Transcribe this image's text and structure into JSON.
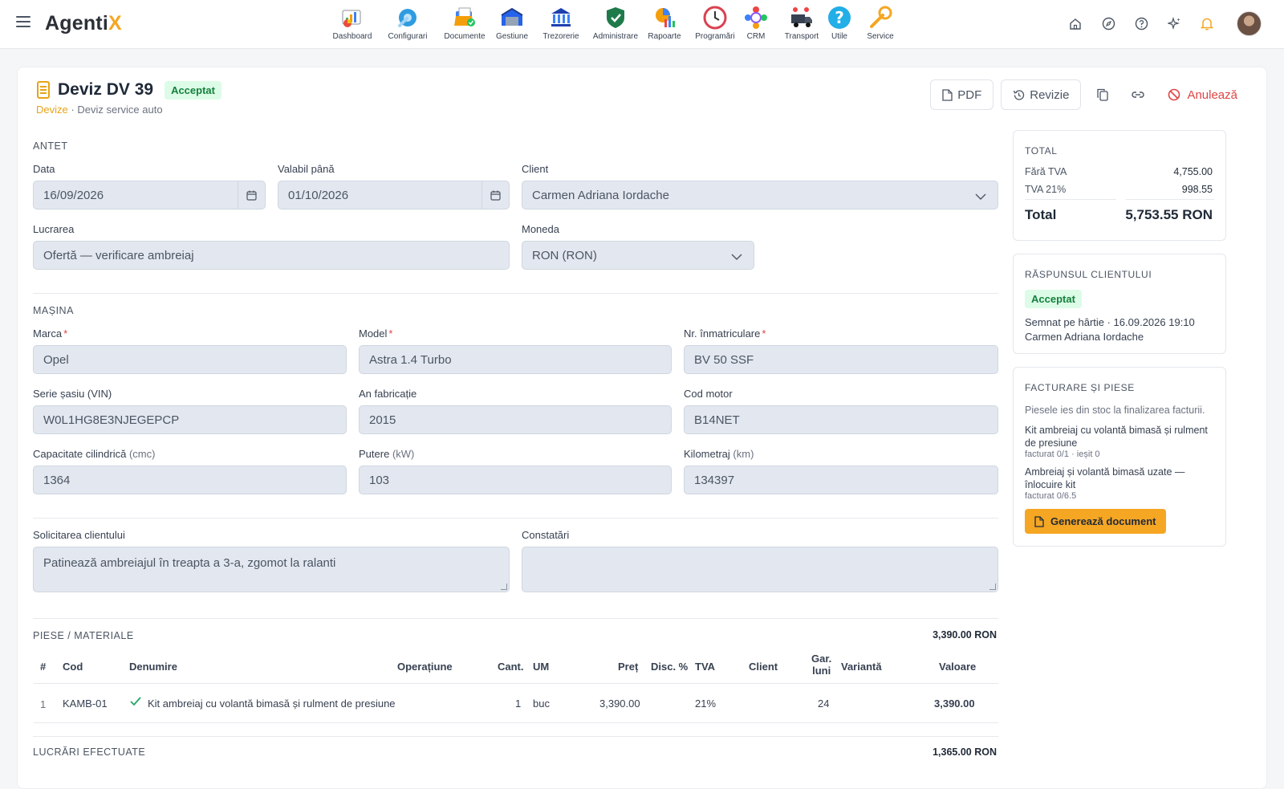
{
  "app": {
    "brand_main": "Agenti",
    "brand_accent": "X",
    "accent_color": "#f5a623"
  },
  "modules": [
    {
      "label": "Dashboard",
      "icon": "dashboard-icon"
    },
    {
      "label": "Configurari",
      "icon": "wrench-gear-icon"
    },
    {
      "label": "Documente",
      "icon": "documents-icon"
    },
    {
      "label": "Gestiune",
      "icon": "warehouse-icon"
    },
    {
      "label": "Trezorerie",
      "icon": "bank-icon"
    },
    {
      "label": "Administrare",
      "icon": "shield-icon"
    },
    {
      "label": "Rapoarte",
      "icon": "reports-icon"
    },
    {
      "label": "Programări",
      "icon": "clock-icon"
    },
    {
      "label": "CRM",
      "icon": "crm-icon"
    },
    {
      "label": "Transport",
      "icon": "truck-icon"
    },
    {
      "label": "Utile",
      "icon": "help-icon"
    },
    {
      "label": "Service",
      "icon": "wrench-icon"
    }
  ],
  "header": {
    "title": "Deviz DV 39",
    "status": "Acceptat",
    "breadcrumb_link": "Devize",
    "breadcrumb_separator": "·",
    "breadcrumb_current": "Deviz service auto",
    "pdf_label": "PDF",
    "revision_label": "Revizie",
    "cancel_label": "Anulează"
  },
  "antet": {
    "section_title": "ANTET",
    "date_label": "Data",
    "date_value": "16/09/2026",
    "valid_label": "Valabil până",
    "valid_value": "01/10/2026",
    "client_label": "Client",
    "client_value": "Carmen Adriana Iordache",
    "work_label": "Lucrarea",
    "work_value": "Ofertă — verificare ambreiaj",
    "currency_label": "Moneda",
    "currency_value": "RON (RON)"
  },
  "car": {
    "section_title": "MAȘINA",
    "make_label": "Marca",
    "make_value": "Opel",
    "model_label": "Model",
    "model_value": "Astra 1.4 Turbo",
    "plate_label": "Nr. înmatriculare",
    "plate_value": "BV 50 SSF",
    "vin_label": "Serie șasiu (VIN)",
    "vin_value": "W0L1HG8E3NJEGEPCP",
    "year_label": "An fabricație",
    "year_value": "2015",
    "engine_label": "Cod motor",
    "engine_value": "B14NET",
    "capacity_label": "Capacitate cilindrică",
    "capacity_unit": "(cmc)",
    "capacity_value": "1364",
    "power_label": "Putere",
    "power_unit": "(kW)",
    "power_value": "103",
    "km_label": "Kilometraj",
    "km_unit": "(km)",
    "km_value": "134397"
  },
  "notes": {
    "request_label": "Solicitarea clientului",
    "request_value": "Patinează ambreiajul în treapta a 3-a, zgomot la ralanti",
    "findings_label": "Constatări",
    "findings_value": ""
  },
  "parts": {
    "section_title": "PIESE / MATERIALE",
    "section_total": "3,390.00 RON",
    "columns": {
      "num": "#",
      "code": "Cod",
      "name": "Denumire",
      "operation": "Operațiune",
      "qty": "Cant.",
      "um": "UM",
      "price": "Preț",
      "disc": "Disc. %",
      "vat": "TVA",
      "client": "Client",
      "warranty_line1": "Gar.",
      "warranty_line2": "luni",
      "variant": "Variantă",
      "value": "Valoare"
    },
    "rows": [
      {
        "num": "1",
        "code": "KAMB-01",
        "name": "Kit ambreiaj cu volantă bimasă și rulment de presiune",
        "operation": "",
        "qty": "1",
        "um": "buc",
        "price": "3,390.00",
        "disc": "",
        "vat": "21%",
        "client": "",
        "warranty": "24",
        "variant": "",
        "value": "3,390.00"
      }
    ]
  },
  "labor": {
    "section_title": "LUCRĂRI EFECTUATE",
    "section_total": "1,365.00 RON"
  },
  "totals": {
    "section_title": "TOTAL",
    "net_label": "Fără TVA",
    "net_value": "4,755.00",
    "vat_label": "TVA 21%",
    "vat_value": "998.55",
    "total_label": "Total",
    "total_value": "5,753.55 RON"
  },
  "response": {
    "section_title": "RĂSPUNSUL CLIENTULUI",
    "status": "Acceptat",
    "signed_text": "Semnat pe hârtie · 16.09.2026 19:10",
    "signed_by": "Carmen Adriana Iordache"
  },
  "billing": {
    "section_title": "FACTURARE ȘI PIESE",
    "note": "Piesele ies din stoc la finalizarea facturii.",
    "items": [
      {
        "name": "Kit ambreiaj cu volantă bimasă și rulment de presiune",
        "status": "facturat 0/1 · ieșit 0"
      },
      {
        "name": "Ambreiaj și volantă bimasă uzate — înlocuire kit",
        "status": "facturat 0/6.5"
      }
    ],
    "generate_label": "Generează document"
  }
}
